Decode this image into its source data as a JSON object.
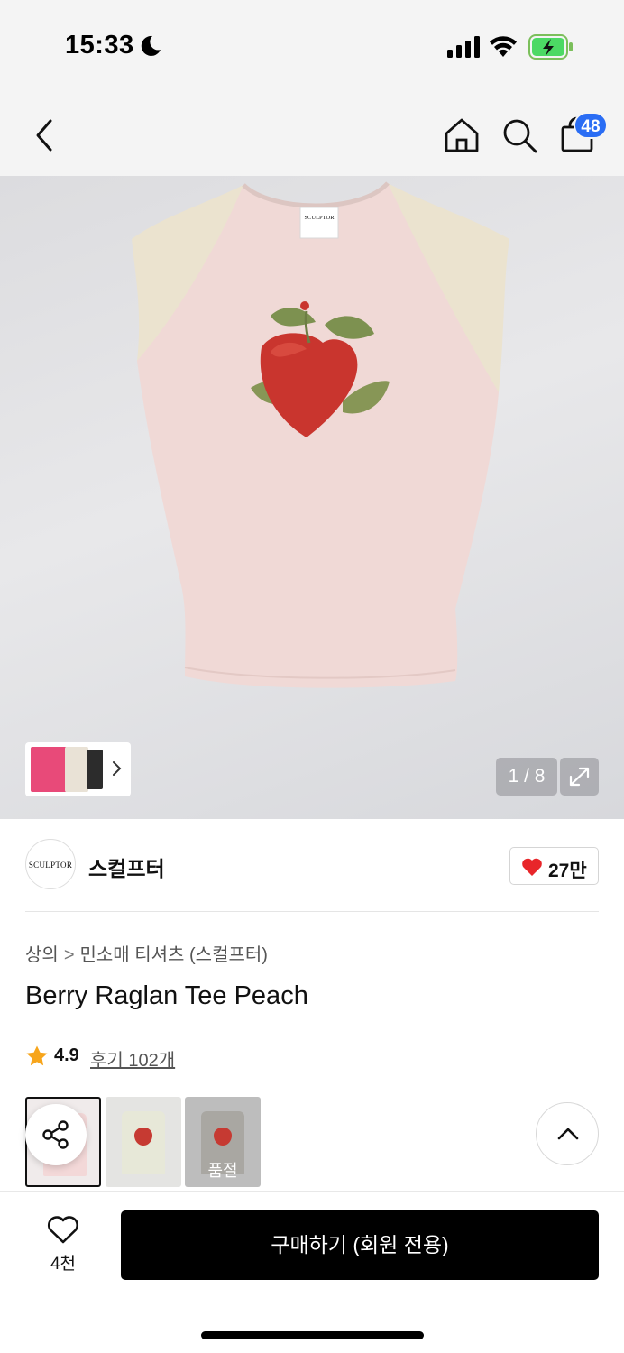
{
  "status_bar": {
    "time": "15:33"
  },
  "header": {
    "cart_count": "48"
  },
  "gallery": {
    "counter": "1 / 8"
  },
  "brand": {
    "logo_text": "SCULPTOR",
    "name": "스컬프터",
    "likes": "27만"
  },
  "breadcrumb": {
    "category": "상의",
    "separator": ">",
    "subcategory": "민소매 티셔츠 (스컬프터)"
  },
  "product": {
    "title": "Berry Raglan Tee Peach",
    "rating": "4.9",
    "reviews": "후기 102개"
  },
  "swatches": [
    {
      "name": "Peach",
      "selected": true
    },
    {
      "name": "Ivory",
      "selected": false
    },
    {
      "name": "Gray",
      "selected": false,
      "status": "품절"
    }
  ],
  "bottom_bar": {
    "wish_count": "4천",
    "buy_label": "구매하기 (회원 전용)"
  },
  "colors": {
    "accent_badge": "#2a6df4",
    "heart": "#e8262a",
    "star": "#f7a51b",
    "buy_button": "#000000"
  },
  "icons": [
    "moon-icon",
    "signal-icon",
    "wifi-icon",
    "battery-icon",
    "back-icon",
    "home-icon",
    "search-icon",
    "cart-icon",
    "chevron-right-icon",
    "expand-icon",
    "heart-icon",
    "star-icon",
    "share-icon",
    "chevron-up-icon",
    "wishlist-heart-icon"
  ]
}
